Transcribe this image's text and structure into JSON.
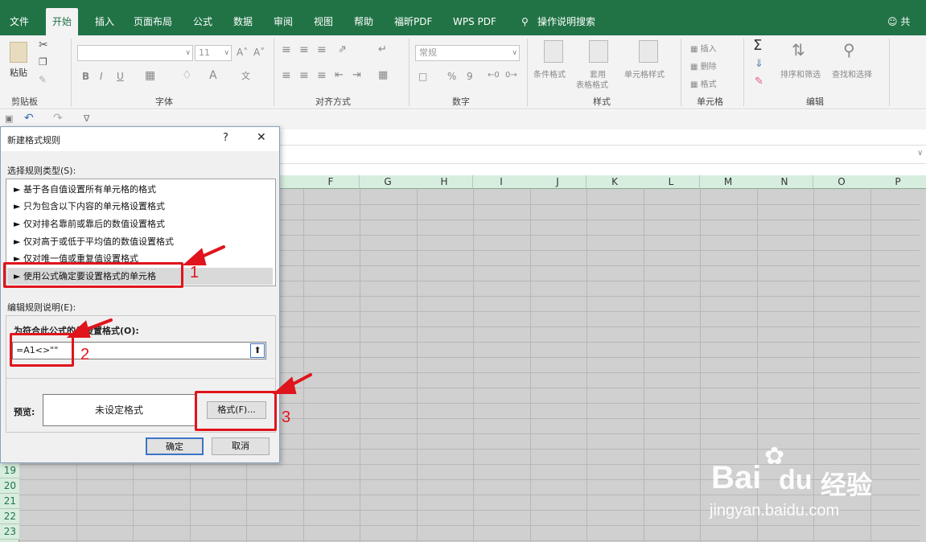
{
  "tabs": [
    "文件",
    "开始",
    "插入",
    "页面布局",
    "公式",
    "数据",
    "审阅",
    "视图",
    "帮助",
    "福昕PDF",
    "WPS PDF",
    "操作说明搜索"
  ],
  "active_tab": "开始",
  "share": "共享",
  "ribbon": {
    "paste": "粘贴",
    "clipboard_group": "剪贴板",
    "font_group": "字体",
    "font_size": "11",
    "bold": "B",
    "italic": "I",
    "underline": "U",
    "grow_font": "A˄",
    "shrink_font": "A˅",
    "align_group": "对齐方式",
    "number_format": "常规",
    "number_group": "数字",
    "percent": "%",
    "comma": "9",
    "cond_format": "条件格式",
    "table_format": "套用\n表格格式",
    "table_format_1": "套用",
    "table_format_2": "表格格式",
    "cell_style": "单元格样式",
    "styles_group": "样式",
    "insert": "插入",
    "delete": "删除",
    "format": "格式",
    "cells_group": "单元格",
    "sum": "Σ",
    "sort_filter": "排序和筛选",
    "find_select": "查找和选择",
    "edit_group": "编辑"
  },
  "columns": [
    "F",
    "G",
    "H",
    "I",
    "J",
    "K",
    "L",
    "M",
    "N",
    "O",
    "P"
  ],
  "rows": [
    "19",
    "20",
    "21",
    "22",
    "23"
  ],
  "dialog": {
    "title": "新建格式规则",
    "help": "?",
    "close": "✕",
    "select_rule_label": "选择规则类型(S):",
    "rules": [
      "► 基于各自值设置所有单元格的格式",
      "► 只为包含以下内容的单元格设置格式",
      "► 仅对排名靠前或靠后的数值设置格式",
      "► 仅对高于或低于平均值的数值设置格式",
      "► 仅对唯一值或重复值设置格式",
      "► 使用公式确定要设置格式的单元格"
    ],
    "edit_desc_label": "编辑规则说明(E):",
    "formula_label": "为符合此公式的值设置格式(O):",
    "formula_value": "=A1<>\"\"",
    "preview_label": "预览:",
    "preview_text": "未设定格式",
    "format_button": "格式(F)...",
    "ok": "确定",
    "cancel": "取消"
  },
  "annotations": [
    "1",
    "2",
    "3"
  ],
  "watermark": {
    "brand": "Bai",
    "brand2": "du",
    "cn": "经验",
    "url": "jingyan.baidu.com"
  },
  "colors": {
    "excel_green": "#217346",
    "red": "#e0141c"
  }
}
